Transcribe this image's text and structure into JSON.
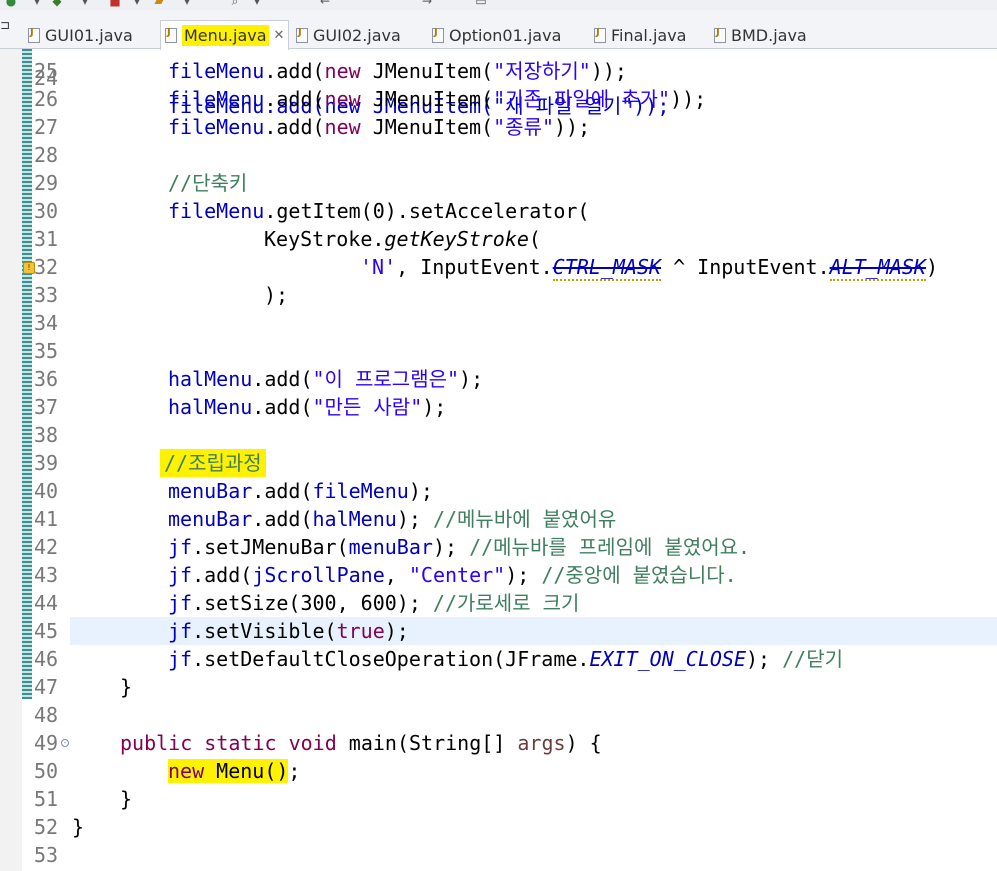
{
  "tabs": [
    {
      "label": "GUI01.java",
      "active": false
    },
    {
      "label": "Menu.java",
      "active": true,
      "highlighted": true
    },
    {
      "label": "GUI02.java",
      "active": false
    },
    {
      "label": "Option01.java",
      "active": false
    },
    {
      "label": "Final.java",
      "active": false
    },
    {
      "label": "BMD.java",
      "active": false
    }
  ],
  "close_glyph": "✕",
  "split_glyph": "⊐",
  "colors": {
    "keyword": "#7f0055",
    "string": "#2a00ff",
    "field": "#0000c0",
    "comment": "#3f7f5f",
    "highlight": "#fff200",
    "current_line": "#e8f2fe"
  },
  "editor": {
    "current_line_number": "45",
    "partial_top_line": {
      "number": "24",
      "text": "fileMenu.add(new JMenuItem(\"새 파일 열기\"));"
    },
    "lines": [
      {
        "num": "25",
        "indent": 2,
        "tokens": [
          {
            "t": "fileMenu",
            "c": "fld"
          },
          {
            "t": ".add("
          },
          {
            "t": "new",
            "c": "kw"
          },
          {
            "t": " JMenuItem("
          },
          {
            "t": "\"저장하기\"",
            "c": "str"
          },
          {
            "t": "));"
          }
        ]
      },
      {
        "num": "26",
        "indent": 2,
        "tokens": [
          {
            "t": "fileMenu",
            "c": "fld"
          },
          {
            "t": ".add("
          },
          {
            "t": "new",
            "c": "kw"
          },
          {
            "t": " JMenuItem("
          },
          {
            "t": "\"기존 파일에 추가\"",
            "c": "str"
          },
          {
            "t": "));"
          }
        ]
      },
      {
        "num": "27",
        "indent": 2,
        "tokens": [
          {
            "t": "fileMenu",
            "c": "fld"
          },
          {
            "t": ".add("
          },
          {
            "t": "new",
            "c": "kw"
          },
          {
            "t": " JMenuItem("
          },
          {
            "t": "\"종류\"",
            "c": "str"
          },
          {
            "t": "));"
          }
        ]
      },
      {
        "num": "28",
        "indent": 0,
        "tokens": []
      },
      {
        "num": "29",
        "indent": 2,
        "tokens": [
          {
            "t": "//단축키",
            "c": "cmt"
          }
        ]
      },
      {
        "num": "30",
        "indent": 2,
        "tokens": [
          {
            "t": "fileMenu",
            "c": "fld"
          },
          {
            "t": ".getItem(0).setAccelerator("
          }
        ]
      },
      {
        "num": "31",
        "indent": 4,
        "tokens": [
          {
            "t": "KeyStroke."
          },
          {
            "t": "getKeyStroke",
            "c": "italic"
          },
          {
            "t": "("
          }
        ]
      },
      {
        "num": "32",
        "indent": 6,
        "tokens": [
          {
            "t": "'N'",
            "c": "str"
          },
          {
            "t": ", InputEvent."
          },
          {
            "t": "CTRL_MASK",
            "c": "strike-squig"
          },
          {
            "t": " ^ InputEvent."
          },
          {
            "t": "ALT_MASK",
            "c": "strike-squig"
          },
          {
            "t": ")"
          }
        ]
      },
      {
        "num": "33",
        "indent": 4,
        "tokens": [
          {
            "t": ");"
          }
        ]
      },
      {
        "num": "34",
        "indent": 0,
        "tokens": []
      },
      {
        "num": "35",
        "indent": 0,
        "tokens": []
      },
      {
        "num": "36",
        "indent": 2,
        "tokens": [
          {
            "t": "halMenu",
            "c": "fld"
          },
          {
            "t": ".add("
          },
          {
            "t": "\"이 프로그램은\"",
            "c": "str"
          },
          {
            "t": ");"
          }
        ]
      },
      {
        "num": "37",
        "indent": 2,
        "tokens": [
          {
            "t": "halMenu",
            "c": "fld"
          },
          {
            "t": ".add("
          },
          {
            "t": "\"만든 사람\"",
            "c": "str"
          },
          {
            "t": ");"
          }
        ]
      },
      {
        "num": "38",
        "indent": 0,
        "tokens": []
      },
      {
        "num": "39",
        "indent": 2,
        "tokens": [
          {
            "t": "//조립과정",
            "c": "cmt-hl"
          }
        ]
      },
      {
        "num": "40",
        "indent": 2,
        "tokens": [
          {
            "t": "menuBar",
            "c": "fld"
          },
          {
            "t": ".add("
          },
          {
            "t": "fileMenu",
            "c": "fld"
          },
          {
            "t": ");"
          }
        ]
      },
      {
        "num": "41",
        "indent": 2,
        "tokens": [
          {
            "t": "menuBar",
            "c": "fld"
          },
          {
            "t": ".add("
          },
          {
            "t": "halMenu",
            "c": "fld"
          },
          {
            "t": "); "
          },
          {
            "t": "//메뉴바에 붙였어유",
            "c": "cmt"
          }
        ]
      },
      {
        "num": "42",
        "indent": 2,
        "tokens": [
          {
            "t": "jf",
            "c": "fld"
          },
          {
            "t": ".setJMenuBar("
          },
          {
            "t": "menuBar",
            "c": "fld"
          },
          {
            "t": "); "
          },
          {
            "t": "//메뉴바를 프레임에 붙였어요.",
            "c": "cmt"
          }
        ]
      },
      {
        "num": "43",
        "indent": 2,
        "tokens": [
          {
            "t": "jf",
            "c": "fld"
          },
          {
            "t": ".add("
          },
          {
            "t": "jScrollPane",
            "c": "fld"
          },
          {
            "t": ", "
          },
          {
            "t": "\"Center\"",
            "c": "str"
          },
          {
            "t": "); "
          },
          {
            "t": "//중앙에 붙였습니다.",
            "c": "cmt"
          }
        ]
      },
      {
        "num": "44",
        "indent": 2,
        "tokens": [
          {
            "t": "jf",
            "c": "fld"
          },
          {
            "t": ".setSize(300, 600); "
          },
          {
            "t": "//가로세로 크기",
            "c": "cmt"
          }
        ]
      },
      {
        "num": "45",
        "indent": 2,
        "tokens": [
          {
            "t": "jf",
            "c": "fld"
          },
          {
            "t": ".setVisible("
          },
          {
            "t": "true",
            "c": "kw"
          },
          {
            "t": ");"
          }
        ]
      },
      {
        "num": "46",
        "indent": 2,
        "tokens": [
          {
            "t": "jf",
            "c": "fld"
          },
          {
            "t": ".setDefaultCloseOperation(JFrame."
          },
          {
            "t": "EXIT_ON_CLOSE",
            "c": "italfld"
          },
          {
            "t": "); "
          },
          {
            "t": "//닫기",
            "c": "cmt"
          }
        ]
      },
      {
        "num": "47",
        "indent": 1,
        "tokens": [
          {
            "t": "}"
          }
        ]
      },
      {
        "num": "48",
        "indent": 0,
        "tokens": []
      },
      {
        "num": "49",
        "indent": 1,
        "tokens": [
          {
            "t": "public",
            "c": "kw"
          },
          {
            "t": " "
          },
          {
            "t": "static",
            "c": "kw"
          },
          {
            "t": " "
          },
          {
            "t": "void",
            "c": "kw"
          },
          {
            "t": " main(String[] "
          },
          {
            "t": "args",
            "c": "param"
          },
          {
            "t": ") {"
          }
        ]
      },
      {
        "num": "50",
        "indent": 2,
        "tokens": [
          {
            "t": "new Menu()",
            "c": "hl"
          },
          {
            "t": ";"
          }
        ]
      },
      {
        "num": "51",
        "indent": 1,
        "tokens": [
          {
            "t": "}"
          }
        ]
      },
      {
        "num": "52",
        "indent": 0,
        "tokens": [
          {
            "t": "}"
          }
        ]
      },
      {
        "num": "53",
        "indent": 0,
        "tokens": []
      }
    ]
  }
}
